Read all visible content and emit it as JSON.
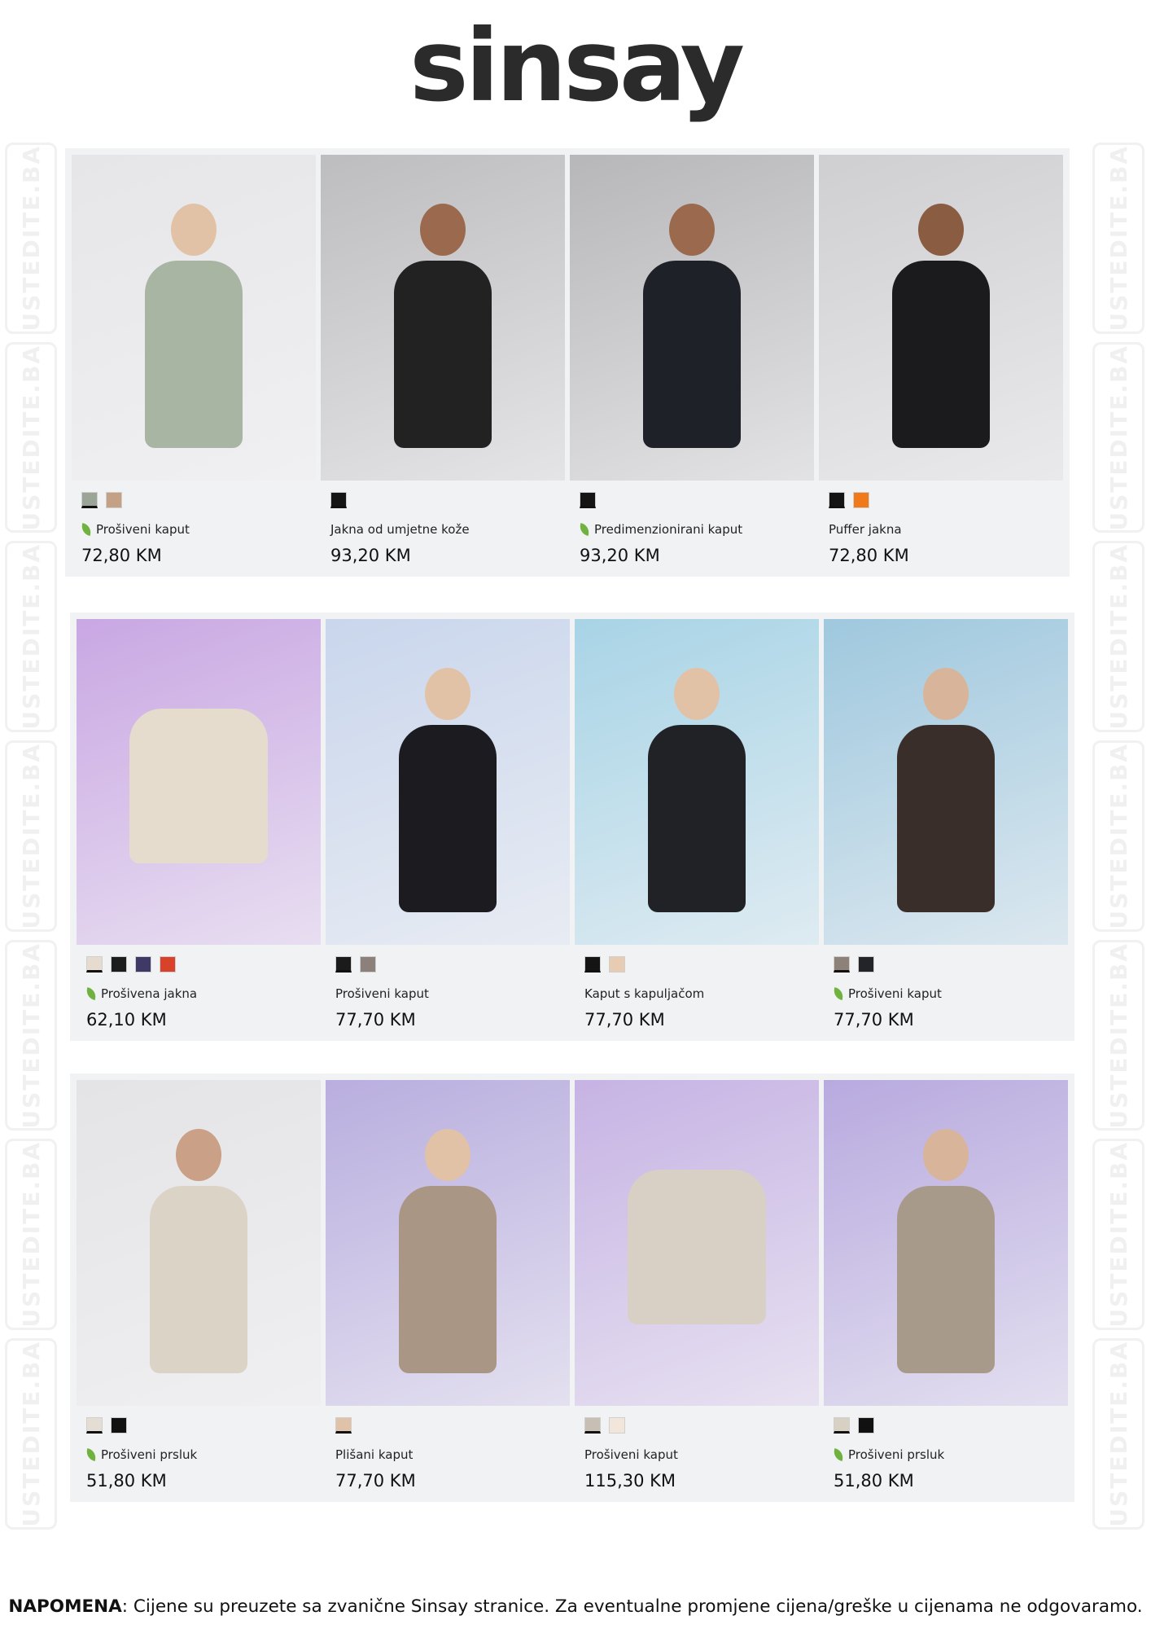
{
  "brand": {
    "logo_text": "sinsay"
  },
  "watermark": {
    "text": "USTEDITE.BA"
  },
  "sections": [
    {
      "products": [
        {
          "name": "Prošiveni kaput",
          "price": "72,80 KM",
          "eco": true,
          "swatches": [
            "#9aa597",
            "#c4a084"
          ],
          "bg": "#e6e6e8",
          "garment": "#a9b5a3",
          "skin": "#e2c2a6"
        },
        {
          "name": "Jakna od umjetne kože",
          "price": "93,20 KM",
          "eco": false,
          "swatches": [
            "#151515"
          ],
          "bg": "#bdbdc0",
          "garment": "#222222",
          "skin": "#9b6a4e"
        },
        {
          "name": "Predimenzionirani kaput",
          "price": "93,20 KM",
          "eco": true,
          "swatches": [
            "#141414"
          ],
          "bg": "#b7b7ba",
          "garment": "#1f2128",
          "skin": "#9b6a4e"
        },
        {
          "name": "Puffer jakna",
          "price": "72,80 KM",
          "eco": false,
          "swatches": [
            "#141414",
            "#f07a1a"
          ],
          "bg": "#cfcfd2",
          "garment": "#1b1b1e",
          "skin": "#8a5c42"
        }
      ]
    },
    {
      "products": [
        {
          "name": "Prošivena jakna",
          "price": "62,10 KM",
          "eco": true,
          "swatches": [
            "#e5dccf",
            "#1d1d1d",
            "#3e3a66",
            "#d9422a"
          ],
          "bg": "#c9a7e3",
          "garment": "#e6dccd",
          "skin": ""
        },
        {
          "name": "Prošiveni kaput",
          "price": "77,70 KM",
          "eco": false,
          "swatches": [
            "#1b1b1b",
            "#8b817a"
          ],
          "bg": "#c9d6ec",
          "garment": "#1c1c20",
          "skin": "#e2c2a6"
        },
        {
          "name": "Kaput s kapuljačom",
          "price": "77,70 KM",
          "eco": false,
          "swatches": [
            "#141414",
            "#e7cbb2"
          ],
          "bg": "#a8d4e6",
          "garment": "#202226",
          "skin": "#e2c2a6"
        },
        {
          "name": "Prošiveni kaput",
          "price": "77,70 KM",
          "eco": true,
          "swatches": [
            "#8e8278",
            "#23232a"
          ],
          "bg": "#9fc8de",
          "garment": "#3a2e2a",
          "skin": "#d8b59a"
        }
      ]
    },
    {
      "products": [
        {
          "name": "Prošiveni prsluk",
          "price": "51,80 KM",
          "eco": true,
          "swatches": [
            "#e3ddd3",
            "#111111"
          ],
          "bg": "#e4e4e6",
          "garment": "#dcd3c7",
          "skin": "#caa086"
        },
        {
          "name": "Plišani kaput",
          "price": "77,70 KM",
          "eco": false,
          "swatches": [
            "#dfc2a7"
          ],
          "bg": "#b9aedf",
          "garment": "#a99684",
          "skin": "#e2c2a6"
        },
        {
          "name": "Prošiveni kaput",
          "price": "115,30 KM",
          "eco": false,
          "swatches": [
            "#c8bfb4",
            "#f1e6d9"
          ],
          "bg": "#c6b3e4",
          "garment": "#d8d0c4",
          "skin": ""
        },
        {
          "name": "Prošiveni prsluk",
          "price": "51,80 KM",
          "eco": true,
          "swatches": [
            "#d9d0c4",
            "#111111"
          ],
          "bg": "#b8aadf",
          "garment": "#a89a8b",
          "skin": "#d8b59a"
        }
      ]
    }
  ],
  "footer": {
    "label": "NAPOMENA",
    "text": ": Cijene su preuzete sa zvanične Sinsay stranice. Za eventualne promjene cijena/greške u cijenama ne odgovaramo."
  }
}
